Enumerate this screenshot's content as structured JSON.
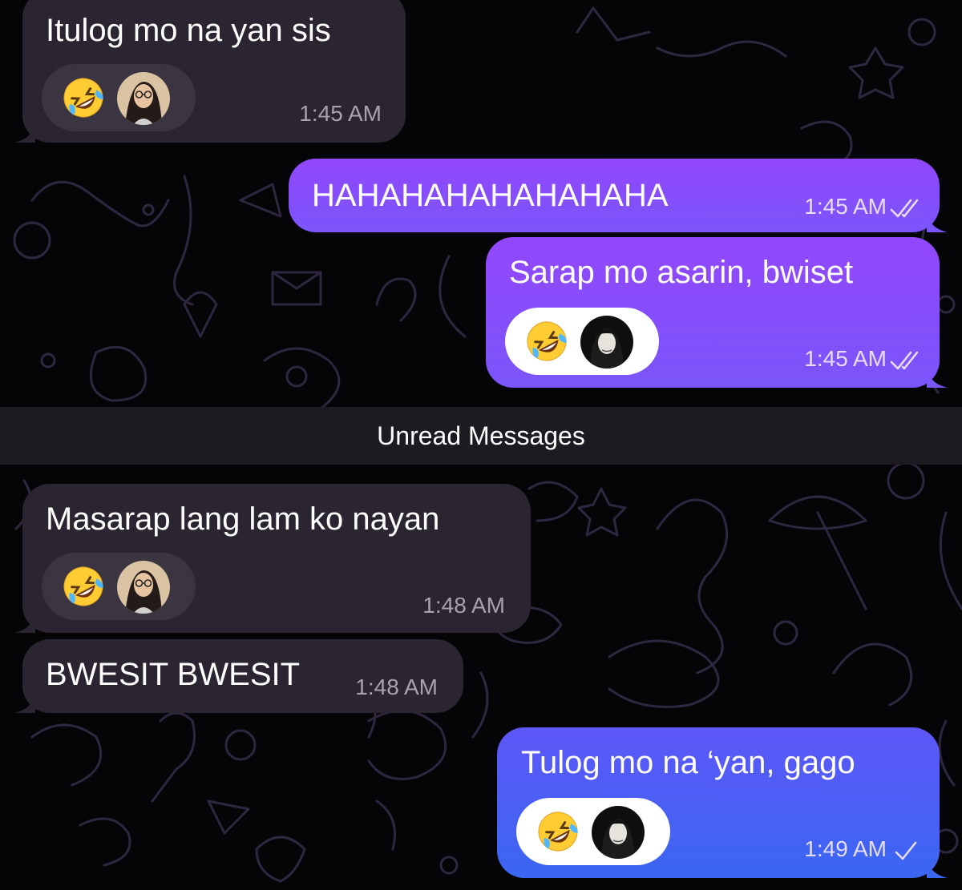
{
  "colors": {
    "background": "#050407",
    "incoming_bubble": "#2a2530",
    "outgoing_bubble_top": "#9247fb",
    "outgoing_bubble_bottom": "#7a55fa",
    "outgoing_blue": "#3a66f2",
    "wallpaper_lines": "#2f2740"
  },
  "divider": {
    "label": "Unread Messages"
  },
  "messages": [
    {
      "direction": "incoming",
      "text": "Itulog mo na yan sis",
      "time": "1:45 AM",
      "reaction": {
        "emoji": "rolling-on-the-floor-laughing",
        "by": "avatar-woman-glasses"
      }
    },
    {
      "direction": "outgoing",
      "text": "HAHAHAHAHAHAHAHA",
      "time": "1:45 AM",
      "status": "read"
    },
    {
      "direction": "outgoing",
      "text": "Sarap mo asarin, bwiset",
      "time": "1:45 AM",
      "status": "read",
      "reaction": {
        "emoji": "rolling-on-the-floor-laughing",
        "by": "avatar-man-hood"
      }
    },
    {
      "direction": "incoming",
      "text": "Masarap lang lam ko nayan",
      "time": "1:48 AM",
      "reaction": {
        "emoji": "rolling-on-the-floor-laughing",
        "by": "avatar-woman-glasses"
      }
    },
    {
      "direction": "incoming",
      "text": "BWESIT BWESIT",
      "time": "1:48 AM"
    },
    {
      "direction": "outgoing",
      "text": "Tulog mo na ‘yan, gago",
      "time": "1:49 AM",
      "status": "sent",
      "reaction": {
        "emoji": "rolling-on-the-floor-laughing",
        "by": "avatar-man-hood"
      }
    }
  ]
}
